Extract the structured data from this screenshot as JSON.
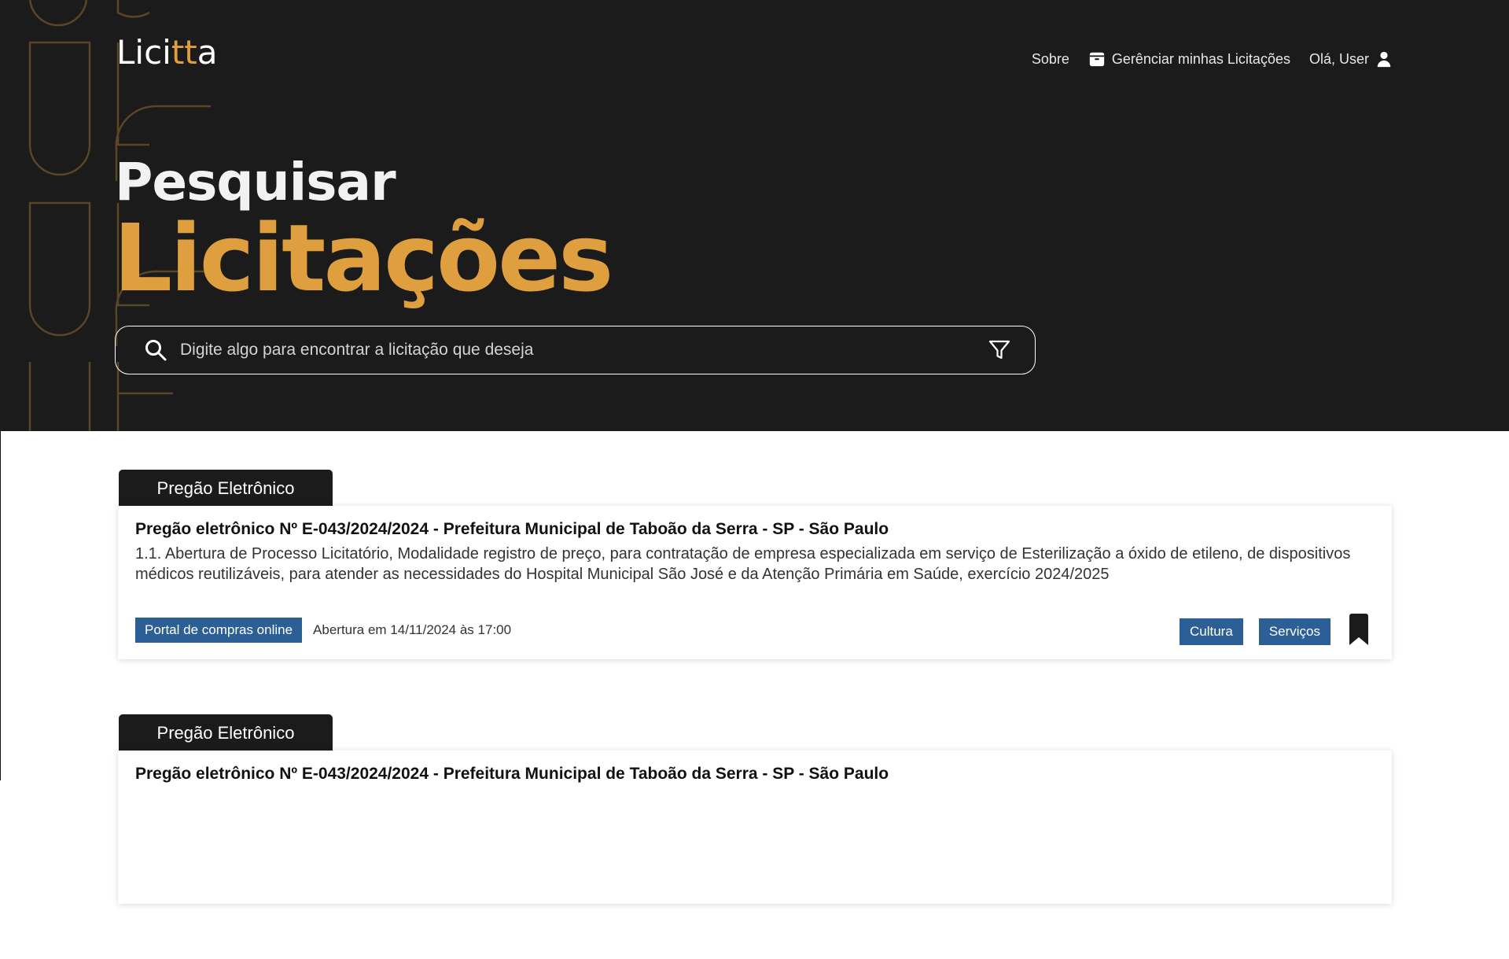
{
  "header": {
    "logo_text_prefix": "Lici",
    "logo_text_accent": "tt",
    "logo_text_suffix": "a",
    "nav": {
      "about_label": "Sobre",
      "manage_label": "Gerênciar minhas Licitações",
      "greeting_label": "Olá, User"
    }
  },
  "hero": {
    "title_line1": "Pesquisar",
    "title_line2": "Licitações",
    "search_placeholder": "Digite algo para encontrar a licitação que deseja",
    "search_value": ""
  },
  "results": [
    {
      "type": "Pregão Eletrônico",
      "title": "Pregão eletrônico Nº E-043/2024/2024 - Prefeitura Municipal de Taboão da Serra - SP - São Paulo",
      "description": "1.1. Abertura de Processo Licitatório, Modalidade registro de preço, para contratação de empresa especializada em serviço de Esterilização a óxido de etileno, de dispositivos médicos reutilizáveis, para atender as necessidades do Hospital Municipal São José e da Atenção Primária em Saúde, exercício 2024/2025",
      "portal": "Portal de compras online",
      "opening": "Abertura em 14/11/2024 às 17:00",
      "tags": [
        "Cultura",
        "Serviços"
      ]
    },
    {
      "type": "Pregão Eletrônico",
      "title": "Pregão eletrônico Nº E-043/2024/2024 - Prefeitura Municipal de Taboão da Serra - SP - São Paulo"
    }
  ],
  "colors": {
    "hero_bg": "#1b1b1b",
    "accent": "#e09f3e",
    "tag_bg": "#2c5f96"
  },
  "icons": [
    "box-icon",
    "user-icon",
    "search-icon",
    "filter-icon",
    "bookmark-icon"
  ]
}
